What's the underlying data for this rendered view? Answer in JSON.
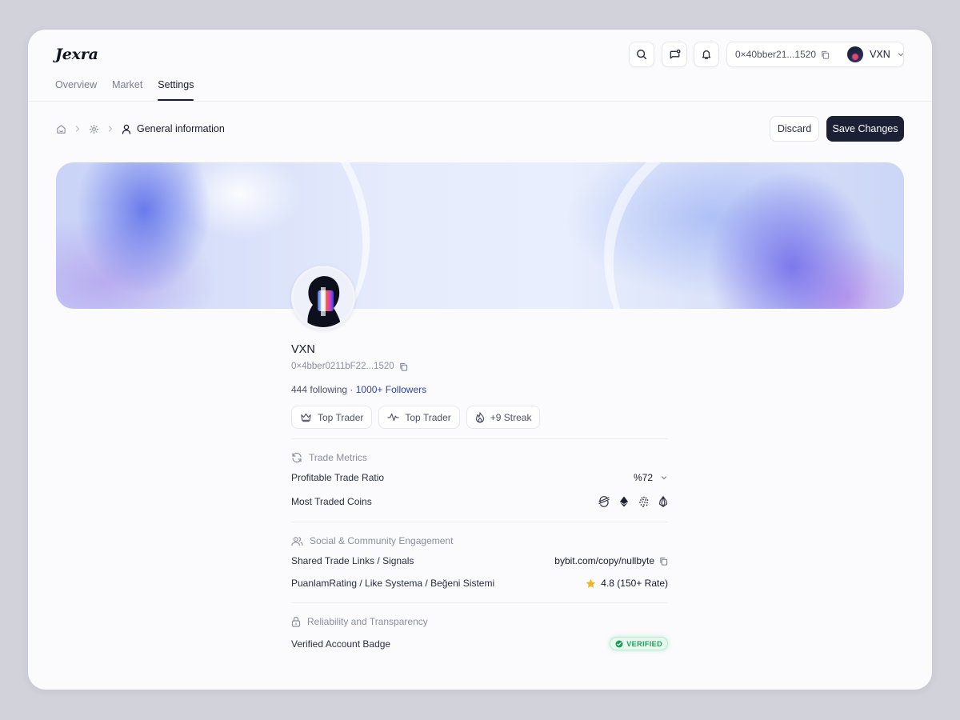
{
  "app": {
    "logo": "Jexra"
  },
  "nav": {
    "tabs": [
      "Overview",
      "Market",
      "Settings"
    ],
    "active": "Settings"
  },
  "topbar": {
    "wallet_address": "0×40bber21...1520",
    "user_name": "VXN"
  },
  "breadcrumb": {
    "current": "General information"
  },
  "actions": {
    "discard": "Discard",
    "save": "Save Changes"
  },
  "profile": {
    "name": "VXN",
    "address": "0×4bber0211bF22...1520",
    "following": "444 following",
    "separator": " · ",
    "followers": "1000+ Followers",
    "badges": [
      "Top Trader",
      "Top Trader",
      "+9 Streak"
    ]
  },
  "trade_metrics": {
    "title": "Trade Metrics",
    "profitable_label": "Profitable Trade Ratio",
    "profitable_value": "%72",
    "most_traded_label": "Most Traded Coins",
    "coins": [
      "stellar-icon",
      "ethereum-icon",
      "iota-icon",
      "eos-icon"
    ]
  },
  "social": {
    "title": "Social & Community Engagement",
    "links_label": "Shared Trade Links / Signals",
    "links_value": "bybit.com/copy/nullbyte",
    "rating_label": "PuanlamRating / Like Systema / Beğeni Sistemi",
    "rating_value": "4.8 (150+ Rate)"
  },
  "reliability": {
    "title": "Reliability and Transparency",
    "badge_label": "Verified Account Badge",
    "badge_value": "VERIFIED"
  },
  "colors": {
    "primary": "#1c2035",
    "link": "#2d45a8",
    "verified": "#1e9a5a",
    "star": "#f4b321"
  }
}
